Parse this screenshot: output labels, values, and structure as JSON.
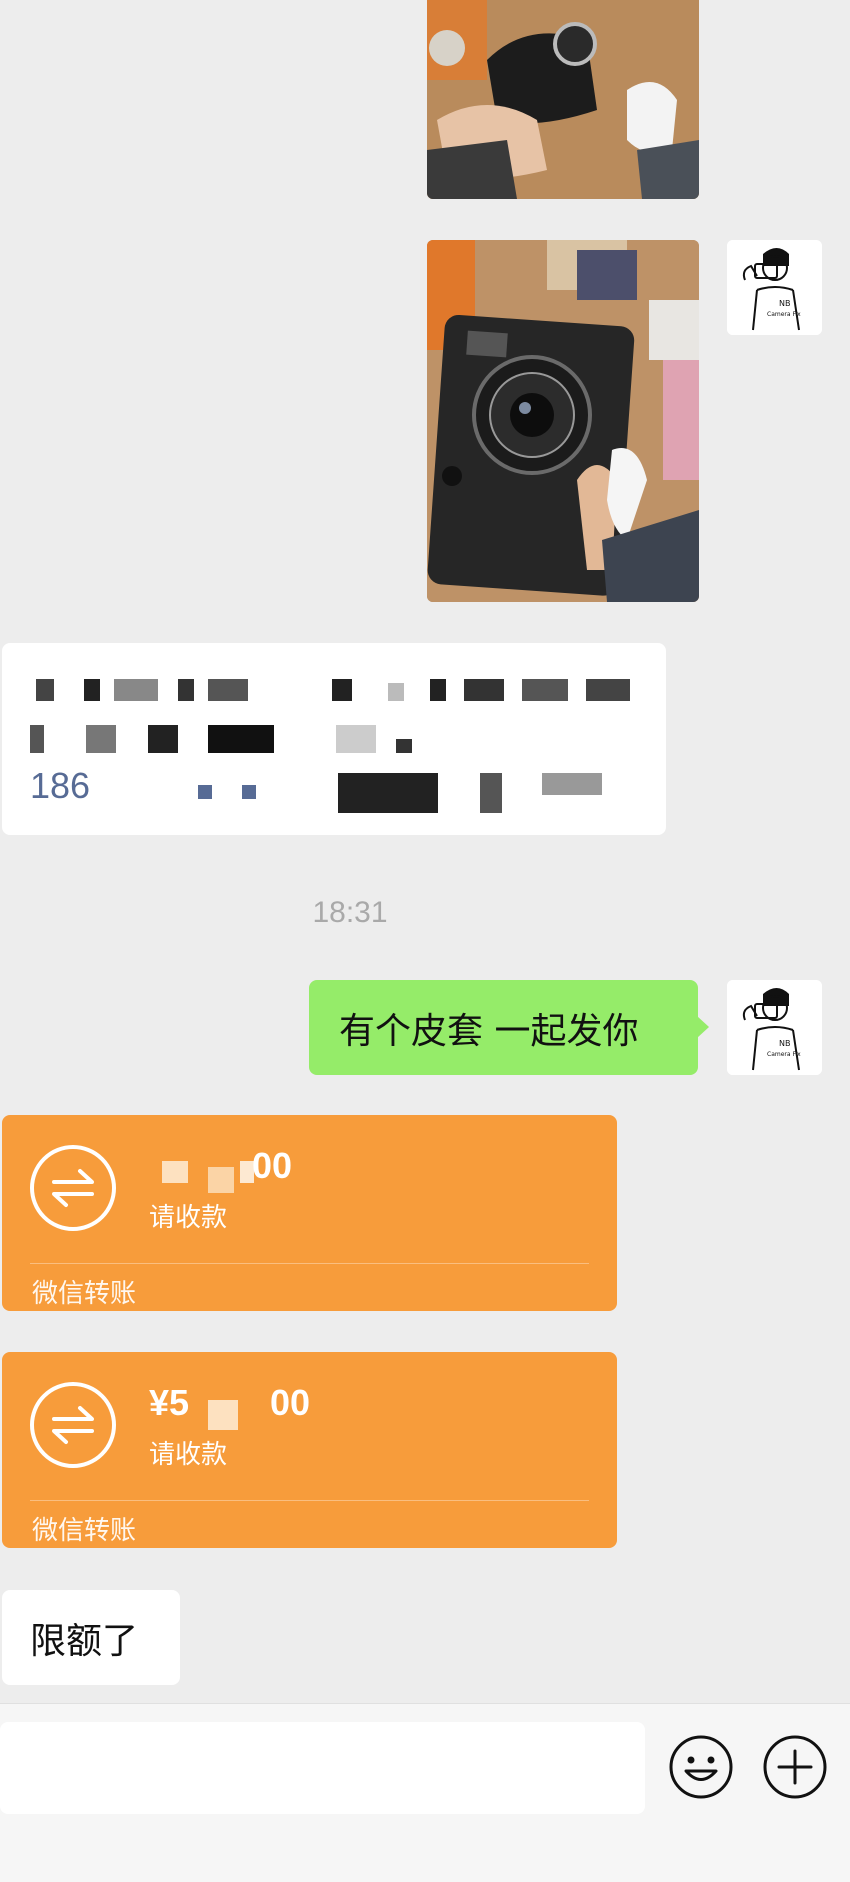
{
  "chat": {
    "time_divider": "18:31",
    "contact_card": {
      "phone_prefix": "186"
    },
    "sent_text": "有个皮套 一起发你",
    "transfers": [
      {
        "amount": "00",
        "status": "请收款",
        "footer": "微信转账"
      },
      {
        "amount": "¥5",
        "amount_end": "00",
        "status": "请收款",
        "footer": "微信转账"
      }
    ],
    "received_text": "限额了"
  },
  "avatar": {
    "line1": "NB",
    "line2": "Camera Fix"
  },
  "input_bar": {
    "placeholder": ""
  },
  "icons": {
    "emoji": "emoji-icon",
    "plus": "plus-icon",
    "transfer": "transfer-arrows-icon"
  },
  "colors": {
    "bubble_green": "#95ec69",
    "transfer_orange": "#f79c3b",
    "background": "#ededed"
  }
}
